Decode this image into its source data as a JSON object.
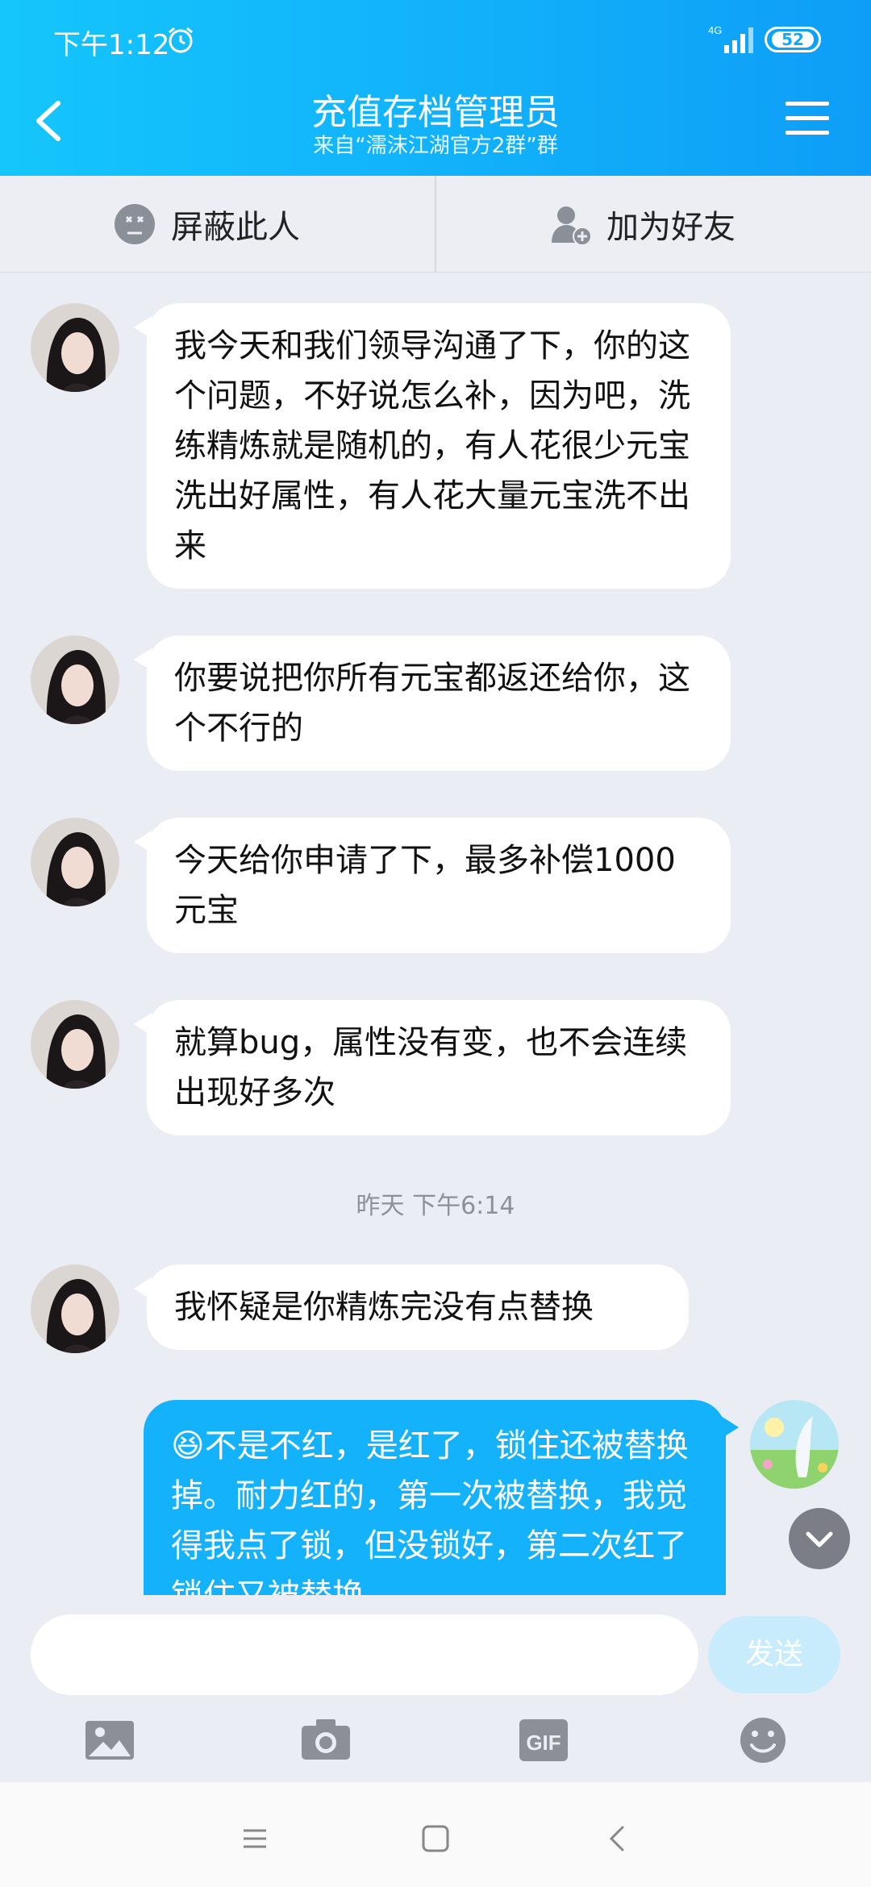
{
  "status": {
    "time": "下午1:12",
    "network": "4G",
    "battery": "52"
  },
  "header": {
    "title": "充值存档管理员",
    "subtitle": "来自“濡沫江湖官方2群”群"
  },
  "actions": {
    "block": "屏蔽此人",
    "add_friend": "加为好友"
  },
  "messages": [
    {
      "sender": "other",
      "text": "我今天和我们领导沟通了下，你的这个问题，不好说怎么补，因为吧，洗练精炼就是随机的，有人花很少元宝洗出好属性，有人花大量元宝洗不出来"
    },
    {
      "sender": "other",
      "text": "你要说把你所有元宝都返还给你，这个不行的"
    },
    {
      "sender": "other",
      "text": "今天给你申请了下，最多补偿1000元宝"
    },
    {
      "sender": "other",
      "text": "就算bug，属性没有变，也不会连续出现好多次"
    },
    {
      "sender": "other",
      "text": "我怀疑是你精炼完没有点替换"
    },
    {
      "sender": "me",
      "text": "😆不是不红，是红了，锁住还被替换掉。耐力红的，第一次被替换，我觉得我点了锁，但没锁好，第二次红了锁住又被替换"
    }
  ],
  "timestamp": "昨天 下午6:14",
  "input": {
    "placeholder": "",
    "send_label": "发送"
  },
  "toolbar": {
    "image": "image-icon",
    "camera": "camera-icon",
    "gif": "GIF",
    "emoji": "emoji-icon"
  },
  "colors": {
    "accent": "#13b2fb",
    "background": "#ebedf5"
  }
}
